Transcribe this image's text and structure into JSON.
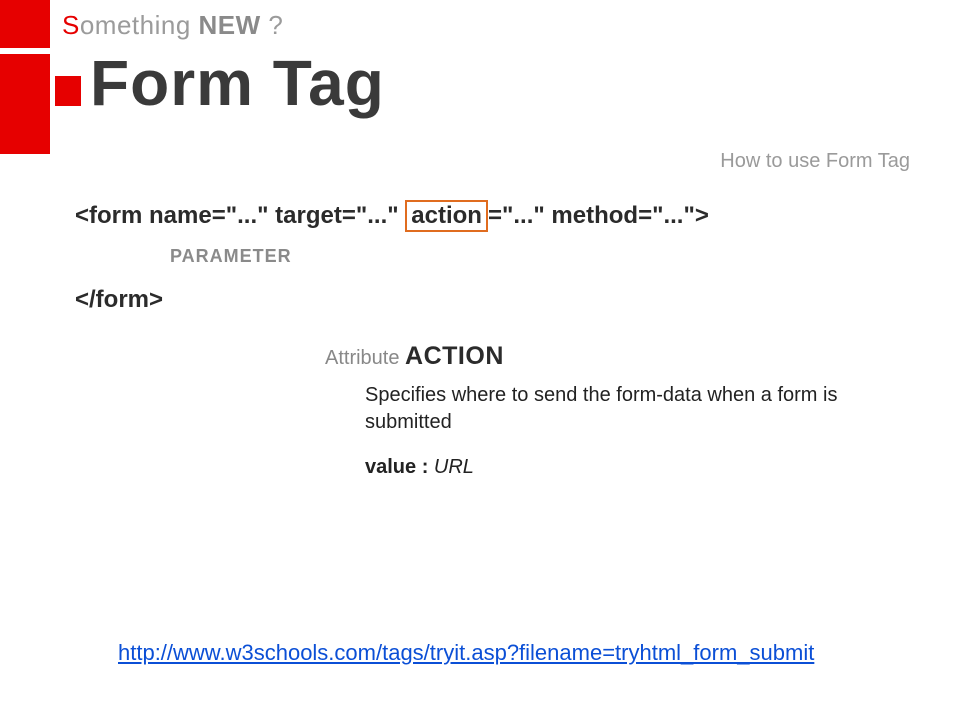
{
  "header": {
    "first_letter": "S",
    "rest_something": "omething ",
    "new": "NEW",
    "tail": " ?"
  },
  "title": "Form Tag",
  "subtitle": "How to use Form Tag",
  "code": {
    "open_pre": "<form name=\"...\" target=\"...\" ",
    "action_word": "action",
    "open_post": "=\"...\" method=\"...\">",
    "parameter_label": "PARAMETER",
    "close": "</form>"
  },
  "attribute": {
    "label": "Attribute ",
    "name": "ACTION",
    "description": "Specifies where to send the form-data when a form is submitted",
    "value_label": "value : ",
    "value_type": "URL"
  },
  "link": "http://www.w3schools.com/tags/tryit.asp?filename=tryhtml_form_submit"
}
